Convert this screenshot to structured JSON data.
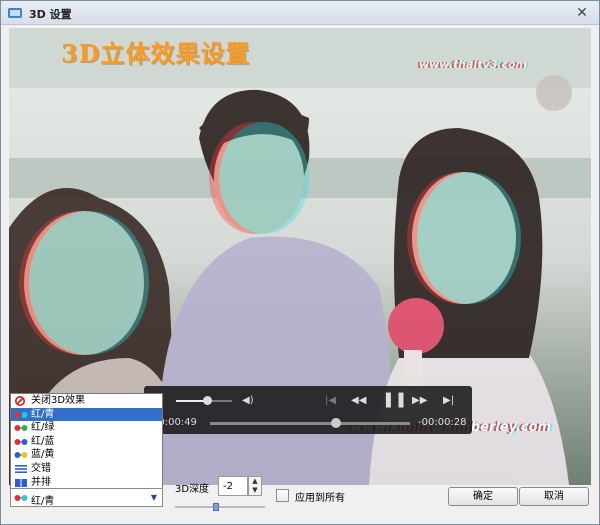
{
  "window": {
    "title": "3D 设置",
    "close": "✕"
  },
  "video": {
    "overlay_title": "3D立体效果设置",
    "channel_url": "www.thaitv3.com",
    "bottom_url": "www.kimmy-kimberley.com"
  },
  "player": {
    "volume": 0.55,
    "progress": 0.63,
    "elapsed": "00:00:49",
    "remaining": "-00:00:28"
  },
  "modes": [
    {
      "label": "关闭3D效果",
      "icon": "no-entry-icon"
    },
    {
      "label": "红/青",
      "icon": "red-cyan-glasses-icon",
      "selected": true
    },
    {
      "label": "红/绿",
      "icon": "red-green-glasses-icon"
    },
    {
      "label": "红/蓝",
      "icon": "red-blue-glasses-icon"
    },
    {
      "label": "蓝/黄",
      "icon": "blue-yellow-glasses-icon"
    },
    {
      "label": "交错",
      "icon": "interlaced-icon"
    },
    {
      "label": "并排",
      "icon": "side-by-side-icon"
    }
  ],
  "mode_select": {
    "value": "红/青"
  },
  "depth": {
    "label": "3D深度",
    "value": "-2",
    "slider_fraction": 0.45
  },
  "apply_all": {
    "label": "应用到所有",
    "checked": false
  },
  "buttons": {
    "ok": "确定",
    "cancel": "取消"
  },
  "colors": {
    "accent": "#3371c8",
    "overlay_title": "#ff9a1e"
  }
}
